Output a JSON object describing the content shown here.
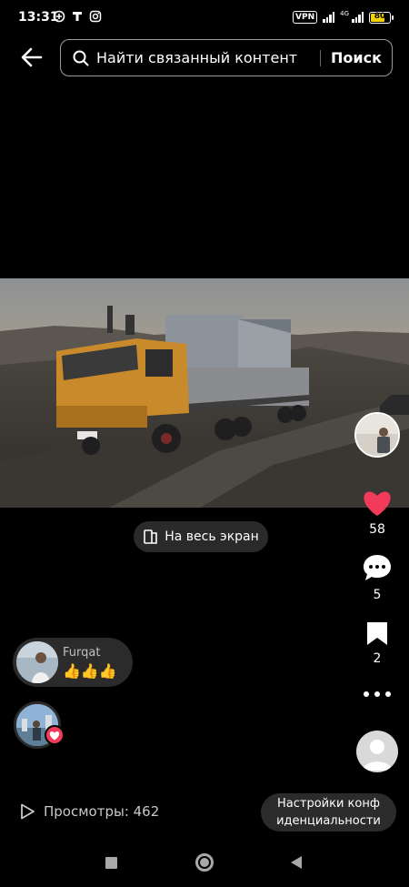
{
  "status_bar": {
    "time": "13:31",
    "vpn_label": "VPN",
    "network_label": "4G",
    "battery_level": "80",
    "battery_fraction": 0.8,
    "icons": [
      "plus-circle-icon",
      "t-logo-icon",
      "instagram-icon",
      "signal-icon",
      "battery-icon"
    ]
  },
  "search": {
    "placeholder": "Найти связанный контент",
    "button_label": "Поиск"
  },
  "video": {
    "fullscreen_label": "На весь экран"
  },
  "actions": {
    "likes": "58",
    "comments": "5",
    "saves": "2"
  },
  "comment": {
    "user": "Furqat",
    "text": "👍👍👍"
  },
  "footer": {
    "views_label": "Просмотры: 462",
    "privacy_button": "Настройки конф иденциальности"
  },
  "colors": {
    "background": "#000000",
    "like_heart": "#f23a5b",
    "pill_background": "#2b2b2b",
    "battery_fill": "#f5d300"
  }
}
